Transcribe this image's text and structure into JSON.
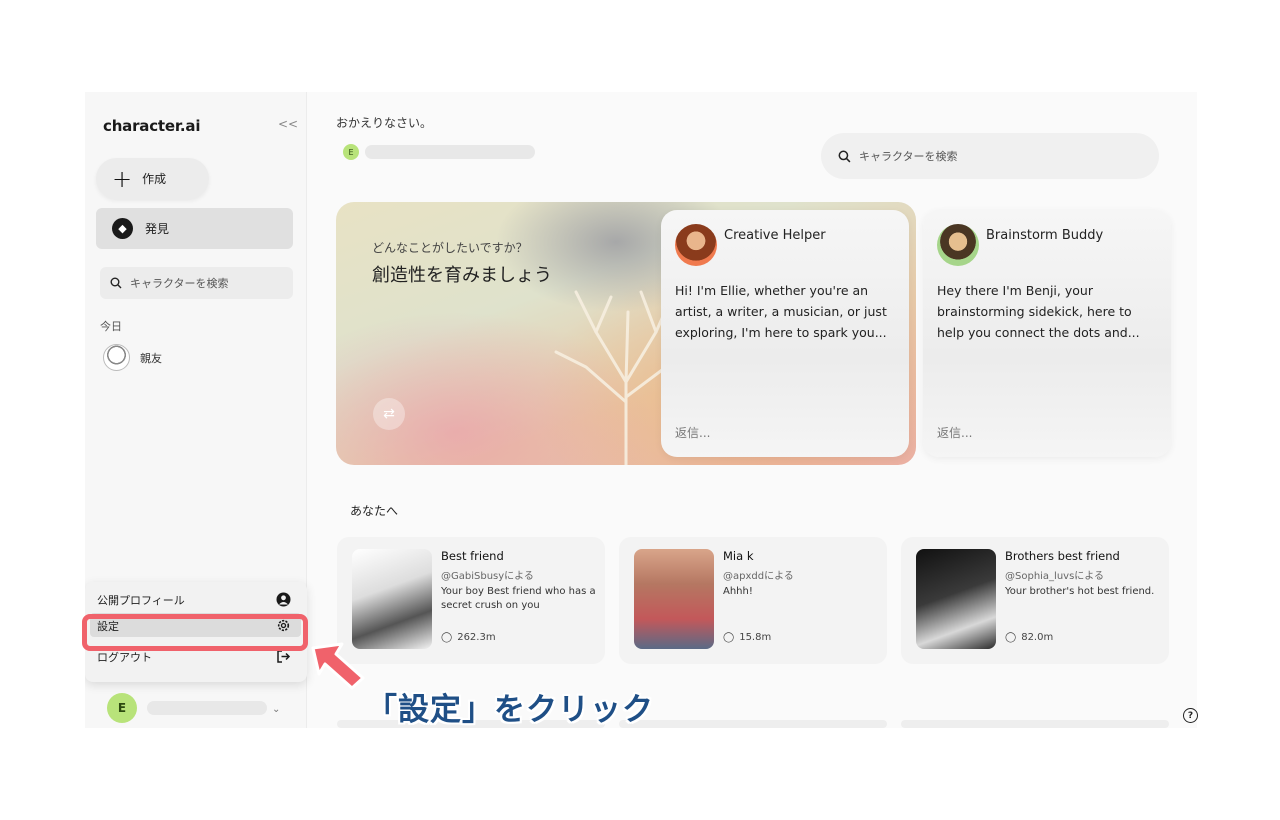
{
  "sidebar": {
    "brand": "character.ai",
    "collapse_icon": "<<",
    "create_label": "作成",
    "discover_label": "発見",
    "search_placeholder": "キャラクターを検索",
    "section_today": "今日",
    "chats": [
      {
        "name": "親友"
      }
    ],
    "user_initial": "E"
  },
  "popup": {
    "items": [
      {
        "label": "公開プロフィール",
        "icon": "user-circle-icon"
      },
      {
        "label": "設定",
        "icon": "gear-icon"
      },
      {
        "label": "ログアウト",
        "icon": "logout-icon"
      }
    ]
  },
  "main": {
    "welcome": "おかえりなさい。",
    "user_initial": "E",
    "search_placeholder": "キャラクターを検索",
    "hero": {
      "subtitle": "どんなことがしたいですか？",
      "title": "創造性を育みましょう"
    },
    "featured": [
      {
        "name": "Creative Helper",
        "desc": "Hi! I'm Ellie, whether you're an artist, a writer, a musician, or just exploring, I'm here to spark you...",
        "reply": "返信..."
      },
      {
        "name": "Brainstorm Buddy",
        "desc": "Hey there I'm Benji, your brainstorming sidekick, here to help you connect the dots and...",
        "reply": "返信..."
      }
    ],
    "for_you_label": "あなたへ",
    "recommendations": [
      {
        "name": "Best friend",
        "handle": "@GabiSbusyによる",
        "desc": "Your boy Best friend who has a secret crush on you",
        "count": "262.3m"
      },
      {
        "name": "Mia k",
        "handle": "@apxddによる",
        "desc": "Ahhh!",
        "count": "15.8m"
      },
      {
        "name": "Brothers best friend",
        "handle": "@Sophia_luvsによる",
        "desc": "Your brother's hot best friend.",
        "count": "82.0m"
      }
    ]
  },
  "annotation": {
    "caption": "「設定」をクリック",
    "color": "#1f4f86",
    "highlight_color": "#f0626b"
  },
  "help_icon": "?"
}
